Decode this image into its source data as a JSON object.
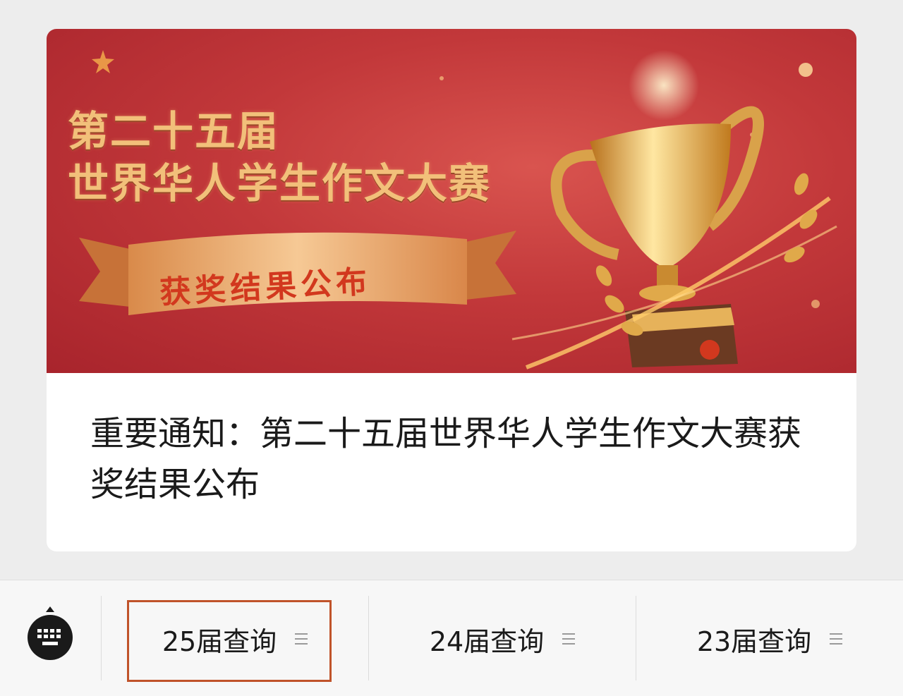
{
  "article": {
    "banner": {
      "title_line1": "第二十五届",
      "title_line2": "世界华人学生作文大赛",
      "ribbon_text": "获奖结果公布"
    },
    "caption": "重要通知：第二十五届世界华人学生作文大赛获奖结果公布"
  },
  "menu": {
    "keyboard_icon": "keyboard-icon",
    "items": [
      {
        "label": "25届查询",
        "icon": "menu-lines-icon"
      },
      {
        "label": "24届查询",
        "icon": "menu-lines-icon"
      },
      {
        "label": "23届查询",
        "icon": "menu-lines-icon"
      }
    ],
    "highlight_color": "#c0532a"
  },
  "colors": {
    "banner_red": "#c2383a",
    "gold": "#f2c07a",
    "ribbon_text": "#d2381e"
  }
}
